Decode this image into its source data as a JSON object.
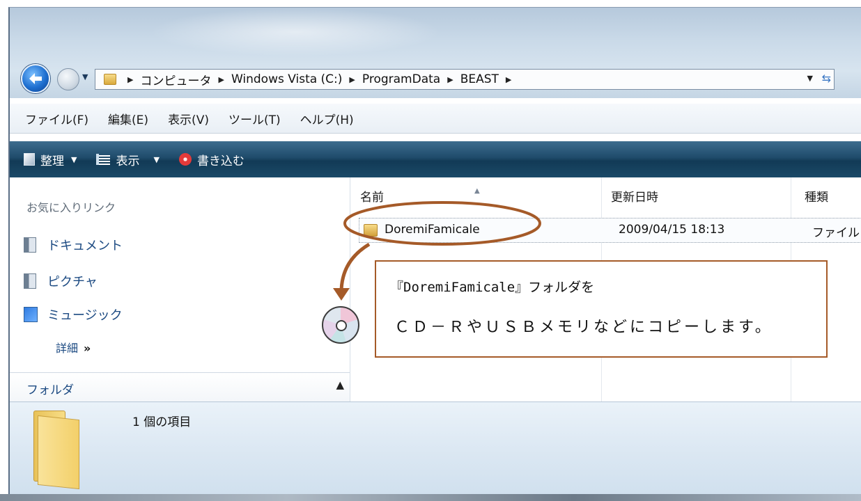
{
  "address_bar": {
    "crumbs": [
      "コンピュータ",
      "Windows Vista (C:)",
      "ProgramData",
      "BEAST"
    ]
  },
  "menu": [
    "ファイル(F)",
    "編集(E)",
    "表示(V)",
    "ツール(T)",
    "ヘルプ(H)"
  ],
  "command_bar": {
    "organize": "整理",
    "views": "表示",
    "burn": "書き込む"
  },
  "nav_pane": {
    "favorites_title": "お気に入りリンク",
    "links": [
      "ドキュメント",
      "ピクチャ",
      "ミュージック"
    ],
    "more": "詳細",
    "more_glyph": "»",
    "folders": "フォルダ"
  },
  "columns": {
    "name": "名前",
    "date": "更新日時",
    "type": "種類"
  },
  "files": [
    {
      "name": "DoremiFamicale",
      "date": "2009/04/15 18:13",
      "type": "ファイル"
    }
  ],
  "details": {
    "count": "1 個の項目"
  },
  "annotation": {
    "line1": "『DoremiFamicale』フォルダを",
    "line2": "ＣＤ－ＲやＵＳＢメモリなどにコピーします。",
    "color": "#a55a28"
  }
}
